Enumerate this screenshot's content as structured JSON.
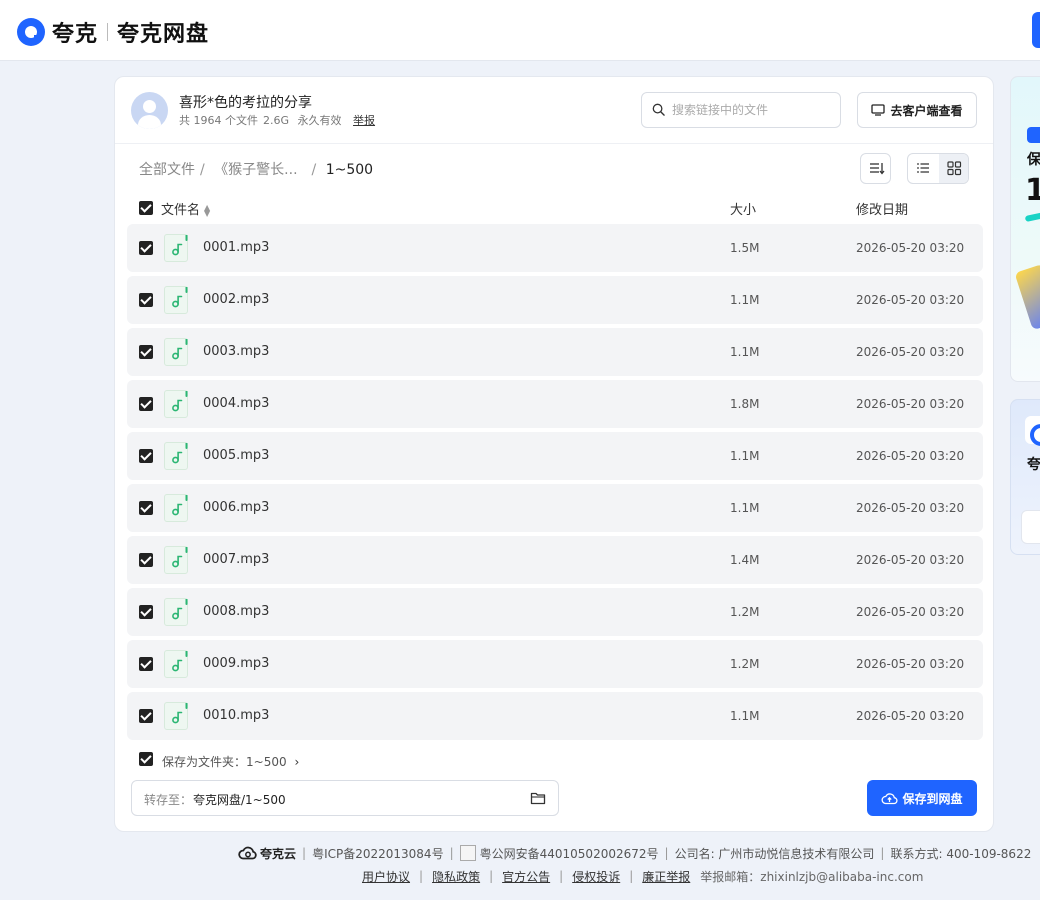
{
  "header": {
    "logo_text": "夸克",
    "logo_sub": "夸克网盘"
  },
  "share": {
    "title": "喜形*色的考拉的分享",
    "file_count": "共 1964 个文件",
    "total_size": "2.6G",
    "validity": "永久有效",
    "report_label": "举报",
    "search_placeholder": "搜索链接中的文件",
    "client_button": "去客户端查看"
  },
  "breadcrumb": {
    "root": "全部文件",
    "middle": "《猴子警长...",
    "current": "1~500"
  },
  "table": {
    "col_name": "文件名",
    "col_size": "大小",
    "col_date": "修改日期",
    "rows": [
      {
        "name": "0001.mp3",
        "size": "1.5M",
        "date": "2026-05-20 03:20"
      },
      {
        "name": "0002.mp3",
        "size": "1.1M",
        "date": "2026-05-20 03:20"
      },
      {
        "name": "0003.mp3",
        "size": "1.1M",
        "date": "2026-05-20 03:20"
      },
      {
        "name": "0004.mp3",
        "size": "1.8M",
        "date": "2026-05-20 03:20"
      },
      {
        "name": "0005.mp3",
        "size": "1.1M",
        "date": "2026-05-20 03:20"
      },
      {
        "name": "0006.mp3",
        "size": "1.1M",
        "date": "2026-05-20 03:20"
      },
      {
        "name": "0007.mp3",
        "size": "1.4M",
        "date": "2026-05-20 03:20"
      },
      {
        "name": "0008.mp3",
        "size": "1.2M",
        "date": "2026-05-20 03:20"
      },
      {
        "name": "0009.mp3",
        "size": "1.2M",
        "date": "2026-05-20 03:20"
      },
      {
        "name": "0010.mp3",
        "size": "1.1M",
        "date": "2026-05-20 03:20"
      }
    ]
  },
  "save": {
    "save_as_folder": "保存为文件夹：1~500",
    "chevron": "›",
    "dest_label": "转存至：",
    "dest_path": "夸克网盘/1~500",
    "save_button": "保存到网盘"
  },
  "ads": {
    "top_line1": "保",
    "top_big": "1",
    "bottom_line1": "夸"
  },
  "footer": {
    "brand": "夸克云",
    "icp": "粤ICP备2022013084号",
    "police": "粤公网安备44010502002672号",
    "company": "公司名: 广州市动悦信息技术有限公司",
    "phone": "联系方式: 400-109-8622",
    "links": [
      "用户协议",
      "隐私政策",
      "官方公告",
      "侵权投诉",
      "廉正举报"
    ],
    "email": "举报邮箱：zhixinlzjb@alibaba-inc.com"
  },
  "colors": {
    "accent": "#1f64ff",
    "background": "#eef2f9",
    "row_bg": "#f3f4f6",
    "audio_icon": "#2bb673"
  }
}
